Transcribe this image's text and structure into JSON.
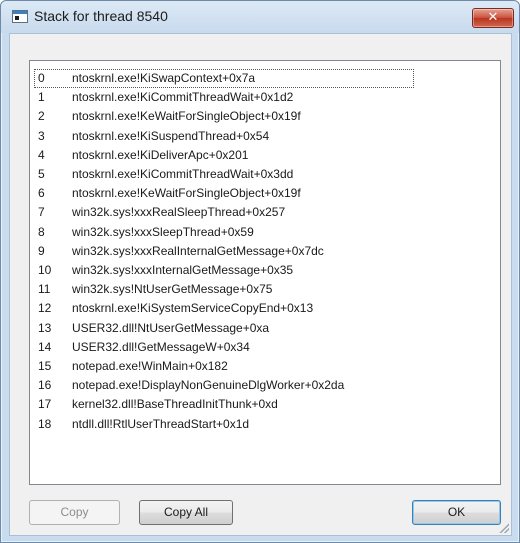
{
  "window": {
    "title": "Stack for thread 8540",
    "close_glyph": "✕"
  },
  "stack_frames": [
    {
      "index": "0",
      "frame": "ntoskrnl.exe!KiSwapContext+0x7a"
    },
    {
      "index": "1",
      "frame": "ntoskrnl.exe!KiCommitThreadWait+0x1d2"
    },
    {
      "index": "2",
      "frame": "ntoskrnl.exe!KeWaitForSingleObject+0x19f"
    },
    {
      "index": "3",
      "frame": "ntoskrnl.exe!KiSuspendThread+0x54"
    },
    {
      "index": "4",
      "frame": "ntoskrnl.exe!KiDeliverApc+0x201"
    },
    {
      "index": "5",
      "frame": "ntoskrnl.exe!KiCommitThreadWait+0x3dd"
    },
    {
      "index": "6",
      "frame": "ntoskrnl.exe!KeWaitForSingleObject+0x19f"
    },
    {
      "index": "7",
      "frame": "win32k.sys!xxxRealSleepThread+0x257"
    },
    {
      "index": "8",
      "frame": "win32k.sys!xxxSleepThread+0x59"
    },
    {
      "index": "9",
      "frame": "win32k.sys!xxxRealInternalGetMessage+0x7dc"
    },
    {
      "index": "10",
      "frame": "win32k.sys!xxxInternalGetMessage+0x35"
    },
    {
      "index": "11",
      "frame": "win32k.sys!NtUserGetMessage+0x75"
    },
    {
      "index": "12",
      "frame": "ntoskrnl.exe!KiSystemServiceCopyEnd+0x13"
    },
    {
      "index": "13",
      "frame": "USER32.dll!NtUserGetMessage+0xa"
    },
    {
      "index": "14",
      "frame": "USER32.dll!GetMessageW+0x34"
    },
    {
      "index": "15",
      "frame": "notepad.exe!WinMain+0x182"
    },
    {
      "index": "16",
      "frame": "notepad.exe!DisplayNonGenuineDlgWorker+0x2da"
    },
    {
      "index": "17",
      "frame": "kernel32.dll!BaseThreadInitThunk+0xd"
    },
    {
      "index": "18",
      "frame": "ntdll.dll!RtlUserThreadStart+0x1d"
    }
  ],
  "buttons": {
    "copy": "Copy",
    "copy_all": "Copy All",
    "ok": "OK"
  }
}
